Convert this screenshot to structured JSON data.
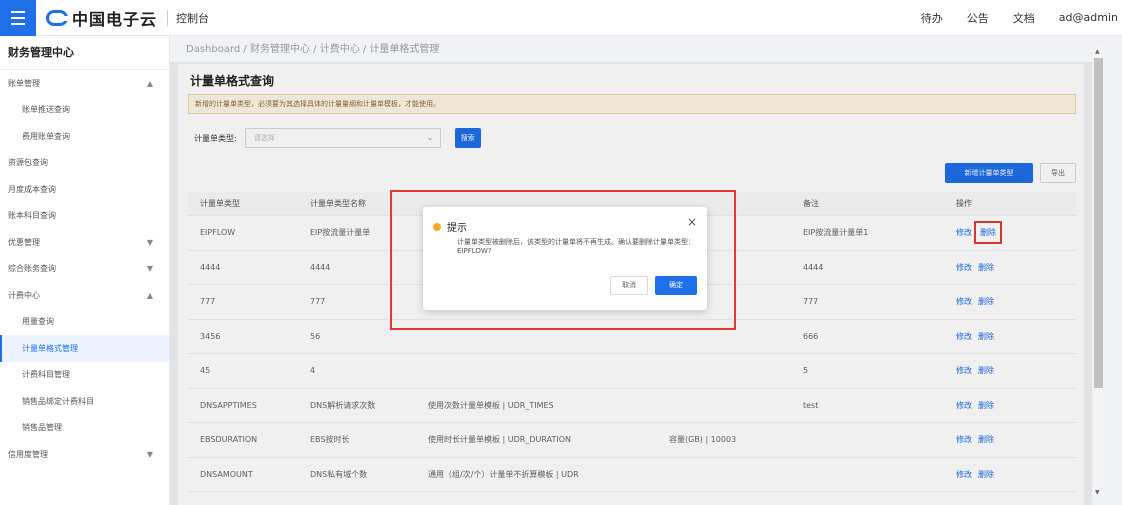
{
  "topbar": {
    "brand": "中国电子云",
    "console": "控制台",
    "links": [
      "待办",
      "公告",
      "文档",
      "ad@admin"
    ]
  },
  "sidebar": {
    "title": "财务管理中心",
    "items": [
      {
        "label": "账单管理",
        "type": "group",
        "arrow": "▲"
      },
      {
        "label": "账单推送查询",
        "type": "sub"
      },
      {
        "label": "费用账单查询",
        "type": "sub"
      },
      {
        "label": "资源包查询",
        "type": "top"
      },
      {
        "label": "月度成本查询",
        "type": "top"
      },
      {
        "label": "账本科目查询",
        "type": "top"
      },
      {
        "label": "优惠管理",
        "type": "group",
        "arrow": "▼"
      },
      {
        "label": "综合账务查询",
        "type": "group",
        "arrow": "▼"
      },
      {
        "label": "计费中心",
        "type": "group",
        "arrow": "▲"
      },
      {
        "label": "用量查询",
        "type": "sub"
      },
      {
        "label": "计量单格式管理",
        "type": "active"
      },
      {
        "label": "计费科目管理",
        "type": "sub"
      },
      {
        "label": "销售品绑定计费科目",
        "type": "sub"
      },
      {
        "label": "销售品管理",
        "type": "sub"
      },
      {
        "label": "信用度管理",
        "type": "group",
        "arrow": "▼"
      }
    ]
  },
  "breadcrumb": "Dashboard / 财务管理中心 / 计费中心 / 计量单格式管理",
  "main": {
    "title": "计量单格式查询",
    "notice": "新增的计量单类型，必须要为其选择具体的计量量纲和计量单模板，才能使用。",
    "filter_label": "计量单类型:",
    "filter_placeholder": "请选择",
    "search_button": "搜索",
    "add_button": "新增计量单类型",
    "export_button": "导出"
  },
  "table": {
    "headers": [
      "计量单类型",
      "计量单类型名称",
      "",
      "",
      "备注",
      "操作"
    ],
    "rows": [
      [
        "EIPFLOW",
        "EIP按流量计量单",
        "",
        "",
        "EIP按流量计量单1"
      ],
      [
        "4444",
        "4444",
        "",
        "",
        "4444"
      ],
      [
        "777",
        "777",
        "",
        "",
        "777"
      ],
      [
        "3456",
        "56",
        "",
        "",
        "666"
      ],
      [
        "45",
        "4",
        "",
        "",
        "5"
      ],
      [
        "DNSAPPTIMES",
        "DNS解析请求次数",
        "使用次数计量单模板 | UDR_TIMES",
        "",
        "test"
      ],
      [
        "EBSDURATION",
        "EBS按时长",
        "使用时长计量单模板 | UDR_DURATION",
        "容量(GB) | 10003",
        ""
      ],
      [
        "DNSAMOUNT",
        "DNS私有域个数",
        "通用（组/次/个）计量单不折算模板 | UDR",
        "",
        ""
      ]
    ],
    "edit_label": "修改",
    "delete_label": "删除"
  },
  "modal": {
    "title": "提示",
    "message": "计量单类型被删除后，该类型的计量单将不再生成。确认要删除计量单类型：EIPFLOW?",
    "cancel": "取消",
    "ok": "确定",
    "close": "×"
  },
  "colors": {
    "primary": "#1e6fe8",
    "highlight": "#e53935",
    "warning": "#f5a623"
  }
}
